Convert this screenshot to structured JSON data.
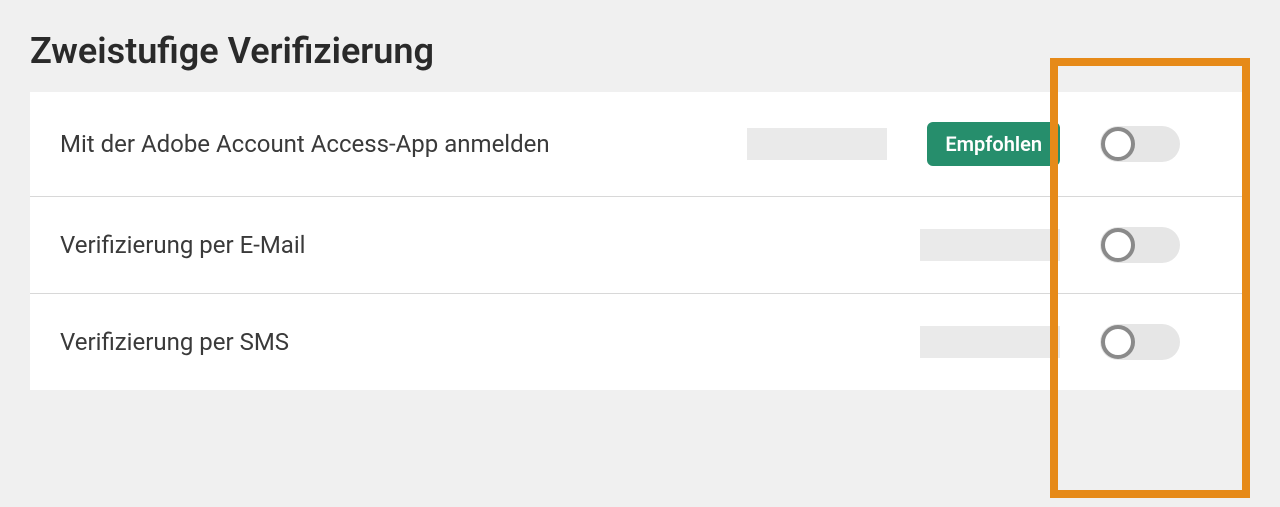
{
  "section": {
    "title": "Zweistufige Verifizierung"
  },
  "options": [
    {
      "label": "Mit der Adobe Account Access-App anmelden",
      "badge": "Empfohlen",
      "toggle": "off"
    },
    {
      "label": "Verifizierung per E-Mail",
      "toggle": "off"
    },
    {
      "label": "Verifizierung per SMS",
      "toggle": "off"
    }
  ],
  "colors": {
    "badge_bg": "#268e6c",
    "highlight": "#e68a19"
  }
}
